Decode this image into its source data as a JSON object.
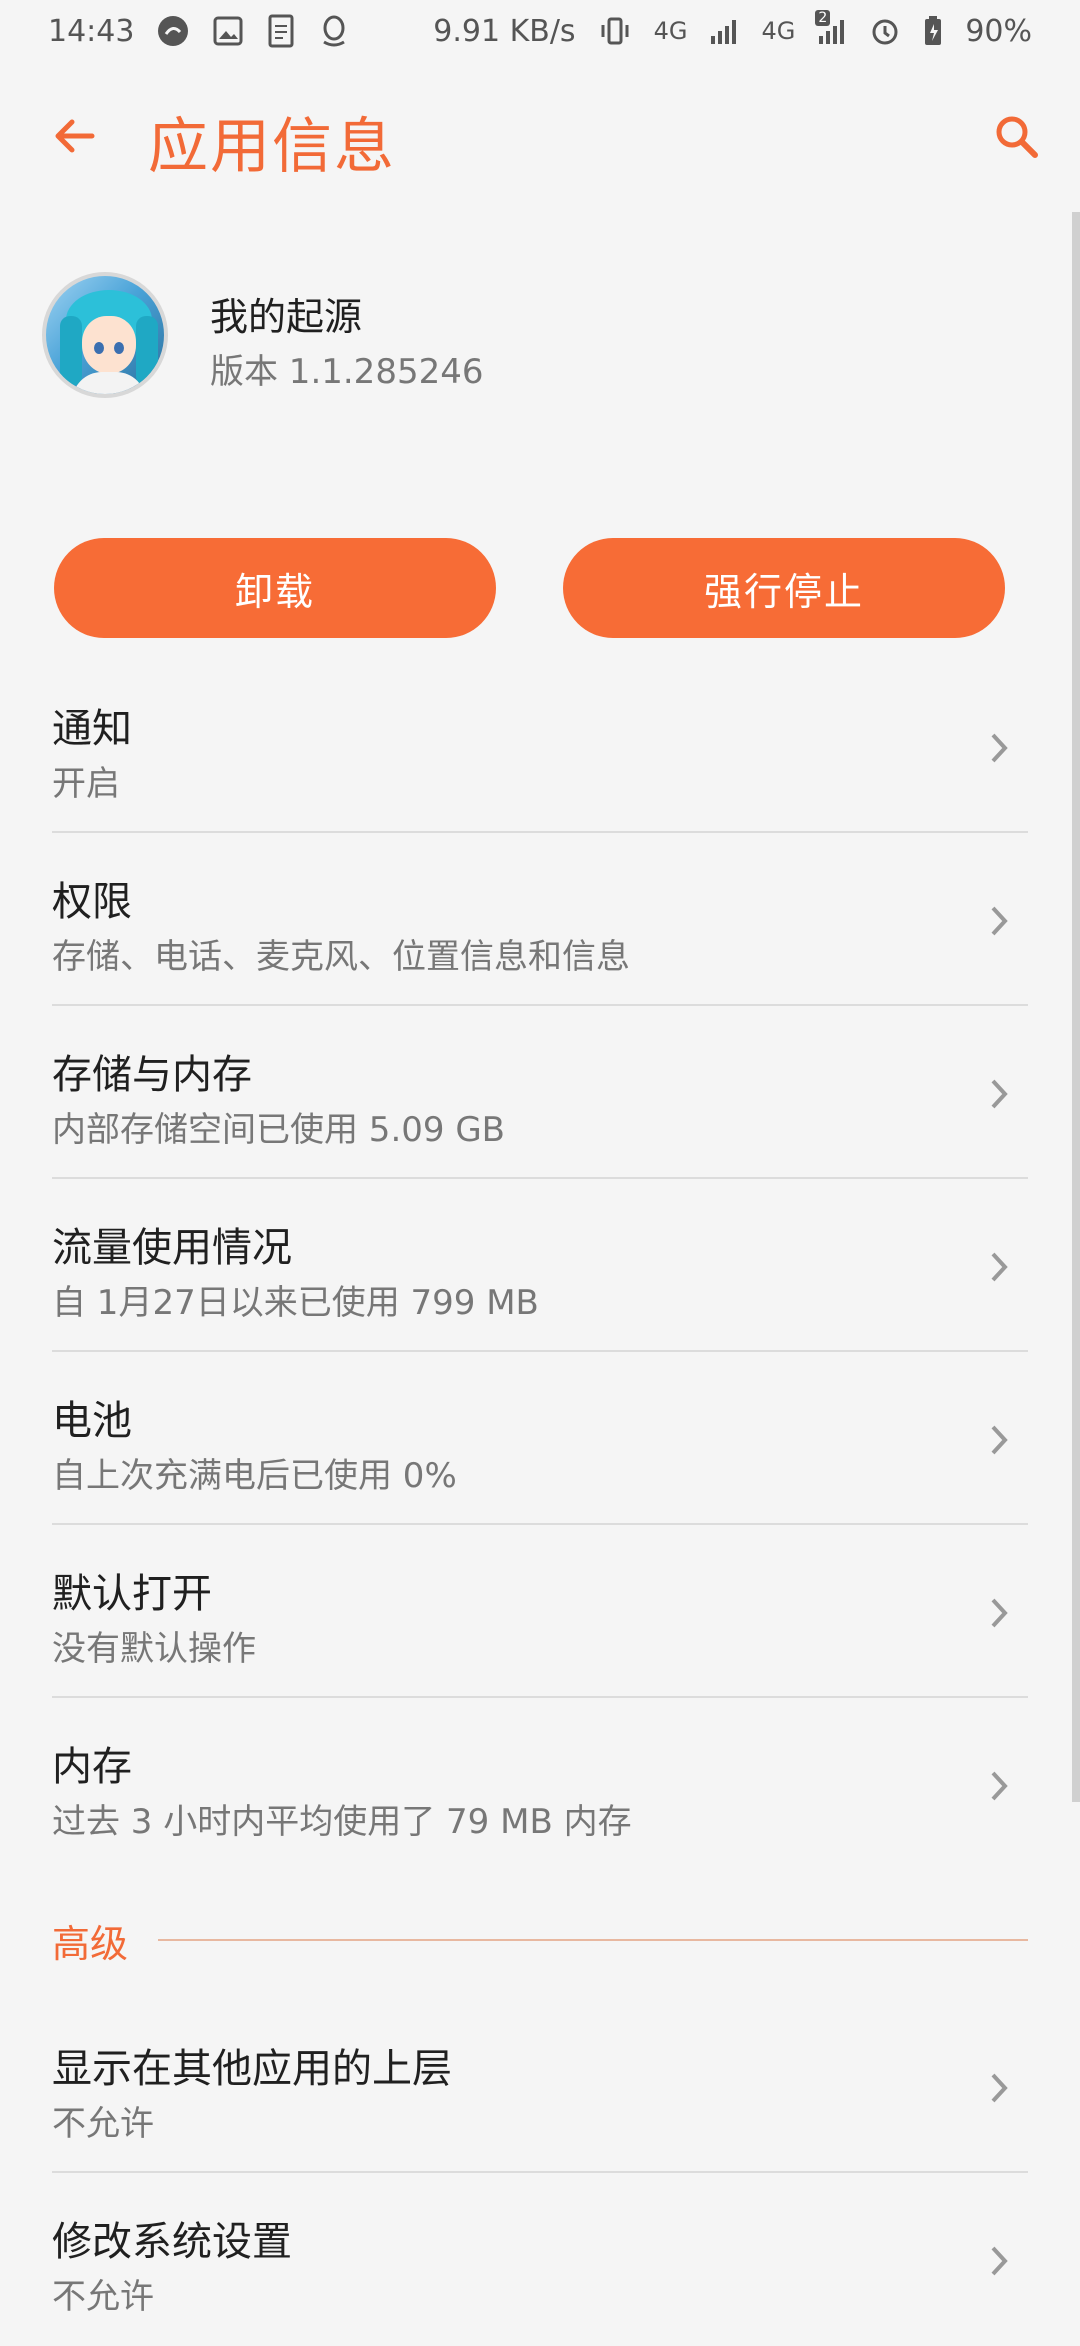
{
  "status_bar": {
    "time": "14:43",
    "speed": "9.91 KB/s",
    "net1": "4G",
    "net2": "4G",
    "sim2_badge": "2",
    "battery": "90%",
    "left_icons": [
      "weibo-icon",
      "gallery-icon",
      "document-icon",
      "qq-icon"
    ],
    "right_icons": [
      "vibrate-icon",
      "signal-icon",
      "alarm-icon",
      "battery-icon"
    ]
  },
  "app_bar": {
    "title": "应用信息",
    "accent_color": "#f26a37"
  },
  "app": {
    "name": "我的起源",
    "version": "版本 1.1.285246"
  },
  "actions": {
    "uninstall": "卸载",
    "force_stop": "强行停止",
    "button_color": "#f76c36"
  },
  "items": [
    {
      "title": "通知",
      "subtitle": "开启"
    },
    {
      "title": "权限",
      "subtitle": "存储、电话、麦克风、位置信息和信息"
    },
    {
      "title": "存储与内存",
      "subtitle": "内部存储空间已使用 5.09 GB"
    },
    {
      "title": "流量使用情况",
      "subtitle": "自 1月27日以来已使用 799 MB"
    },
    {
      "title": "电池",
      "subtitle": "自上次充满电后已使用 0%"
    },
    {
      "title": "默认打开",
      "subtitle": "没有默认操作"
    },
    {
      "title": "内存",
      "subtitle": "过去 3 小时内平均使用了 79 MB 内存"
    }
  ],
  "advanced": {
    "label": "高级",
    "items": [
      {
        "title": "显示在其他应用的上层",
        "subtitle": "不允许"
      },
      {
        "title": "修改系统设置",
        "subtitle": "不允许"
      }
    ]
  }
}
